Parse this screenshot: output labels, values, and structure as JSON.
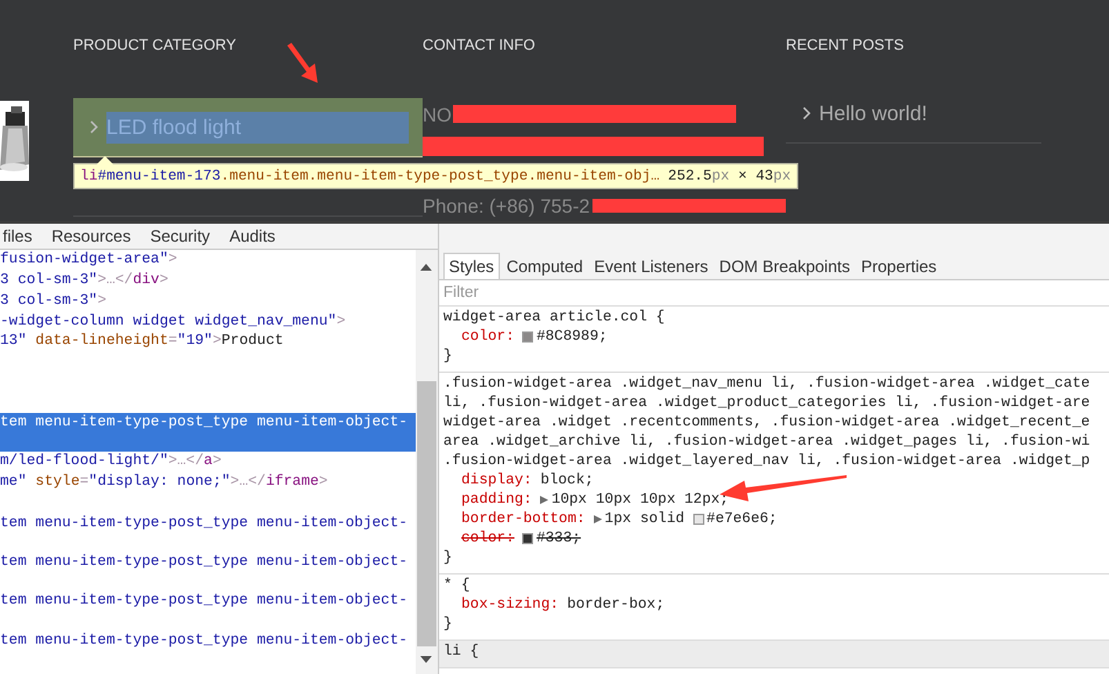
{
  "footer": {
    "columns": [
      {
        "kind": "menu",
        "heading": "PRODUCT CATEGORY",
        "items": [
          {
            "label": "LED flood light",
            "highlighted": true
          }
        ]
      },
      {
        "kind": "contact",
        "heading": "CONTACT INFO",
        "lines": [
          {
            "kind": "text-redacted",
            "text": "NO"
          },
          {
            "kind": "redacted"
          },
          {
            "kind": "text-redacted",
            "text": "Phone: (+86) 755-2"
          }
        ]
      },
      {
        "kind": "menu",
        "heading": "RECENT POSTS",
        "items": [
          {
            "label": "Hello world!",
            "highlighted": false
          }
        ]
      }
    ]
  },
  "inspect_tooltip": {
    "selector": [
      {
        "kind": "tag",
        "text": "li"
      },
      {
        "kind": "id",
        "text": "#menu-item-173"
      },
      {
        "kind": "class",
        "text": ".menu-item.menu-item-type-post_type.menu-item-obj…"
      }
    ],
    "size": [
      {
        "kind": "num",
        "text": "252.5"
      },
      {
        "kind": "unit",
        "text": "px"
      },
      {
        "kind": "sep",
        "text": " × "
      },
      {
        "kind": "num",
        "text": "43"
      },
      {
        "kind": "unit",
        "text": "px"
      }
    ]
  },
  "devtools": {
    "panel_tabs": [
      {
        "label": "files",
        "selected": false
      },
      {
        "label": "Resources",
        "selected": false
      },
      {
        "label": "Security",
        "selected": false
      },
      {
        "label": "Audits",
        "selected": false
      }
    ],
    "dom_lines": [
      {
        "selected": false,
        "tokens": [
          {
            "kind": "value",
            "text": " fusion-widget-area\""
          },
          {
            "kind": "punct",
            "text": ">"
          }
        ]
      },
      {
        "selected": false,
        "tokens": [
          {
            "kind": "value",
            "text": "3 col-sm-3\""
          },
          {
            "kind": "punct",
            "text": ">…</"
          },
          {
            "kind": "tag",
            "text": "div"
          },
          {
            "kind": "punct",
            "text": ">"
          }
        ]
      },
      {
        "selected": false,
        "tokens": [
          {
            "kind": "value",
            "text": "3 col-sm-3\""
          },
          {
            "kind": "punct",
            "text": ">"
          }
        ]
      },
      {
        "selected": false,
        "tokens": [
          {
            "kind": "value",
            "text": "-widget-column widget widget_nav_menu\""
          },
          {
            "kind": "punct",
            "text": ">"
          }
        ]
      },
      {
        "selected": false,
        "tokens": [
          {
            "kind": "value",
            "text": "13\""
          },
          {
            "kind": "attr",
            "text": " data-lineheight"
          },
          {
            "kind": "punct",
            "text": "="
          },
          {
            "kind": "value",
            "text": "\"19\""
          },
          {
            "kind": "punct",
            "text": ">"
          },
          {
            "kind": "text",
            "text": "Product"
          }
        ]
      },
      {
        "selected": true,
        "tokens": [
          {
            "kind": "value",
            "text": "tem menu-item-type-post_type menu-item-object-"
          }
        ]
      },
      {
        "selected": false,
        "tokens": [
          {
            "kind": "value",
            "text": "m/led-flood-light/\""
          },
          {
            "kind": "punct",
            "text": ">…</"
          },
          {
            "kind": "tag",
            "text": "a"
          },
          {
            "kind": "punct",
            "text": ">"
          }
        ]
      },
      {
        "selected": false,
        "tokens": [
          {
            "kind": "value",
            "text": "me\""
          },
          {
            "kind": "attr",
            "text": " style"
          },
          {
            "kind": "punct",
            "text": "="
          },
          {
            "kind": "value",
            "text": "\"display: none;\""
          },
          {
            "kind": "punct",
            "text": ">…</"
          },
          {
            "kind": "tag",
            "text": "iframe"
          },
          {
            "kind": "punct",
            "text": ">"
          }
        ]
      },
      {
        "selected": false,
        "tokens": [
          {
            "kind": "value",
            "text": "tem menu-item-type-post_type menu-item-object-"
          }
        ]
      },
      {
        "selected": false,
        "tokens": [
          {
            "kind": "value",
            "text": "tem menu-item-type-post_type menu-item-object-"
          }
        ]
      },
      {
        "selected": false,
        "tokens": [
          {
            "kind": "value",
            "text": "tem menu-item-type-post_type menu-item-object-"
          }
        ]
      },
      {
        "selected": false,
        "tokens": [
          {
            "kind": "value",
            "text": "tem menu-item-type-post_type menu-item-object-"
          }
        ]
      }
    ],
    "sidebar_tabs": [
      {
        "label": "Styles",
        "selected": true
      },
      {
        "label": "Computed",
        "selected": false
      },
      {
        "label": "Event Listeners",
        "selected": false
      },
      {
        "label": "DOM Breakpoints",
        "selected": false
      },
      {
        "label": "Properties",
        "selected": false
      }
    ],
    "filter": {
      "placeholder": "Filter"
    },
    "rules": [
      {
        "kind": "rule",
        "selector_lines": [
          "widget-area article.col {"
        ],
        "declarations": [
          {
            "name": "color:",
            "swatch": true,
            "value": "#8C8989;",
            "expandable": false,
            "overridden": false
          }
        ],
        "close": "}"
      },
      {
        "kind": "rule",
        "selector_lines": [
          ".fusion-widget-area .widget_nav_menu li, .fusion-widget-area .widget_cate",
          "li, .fusion-widget-area .widget_product_categories li, .fusion-widget-are",
          "widget-area .widget .recentcomments, .fusion-widget-area .widget_recent_e",
          "area .widget_archive li, .fusion-widget-area .widget_pages li, .fusion-wi",
          ".fusion-widget-area .widget_layered_nav li, .fusion-widget-area .widget_p"
        ],
        "declarations": [
          {
            "name": "display:",
            "value": "block;",
            "expandable": false,
            "overridden": false
          },
          {
            "name": "padding:",
            "value": "10px 10px 10px 12px;",
            "expandable": true,
            "overridden": false
          },
          {
            "name": "border-bottom:",
            "pre": "1px solid",
            "swatch": true,
            "value": "#e7e6e6;",
            "expandable": true,
            "overridden": false
          },
          {
            "name": "color:",
            "swatch": true,
            "value": "#333;",
            "expandable": false,
            "overridden": true
          }
        ],
        "close": "}"
      },
      {
        "kind": "rule",
        "selector_lines": [
          "* {"
        ],
        "declarations": [
          {
            "name": "box-sizing:",
            "value": "border-box;",
            "expandable": false,
            "overridden": false
          }
        ],
        "close": "}"
      },
      {
        "kind": "user-agent",
        "selector_lines": [
          "li {"
        ]
      }
    ]
  }
}
